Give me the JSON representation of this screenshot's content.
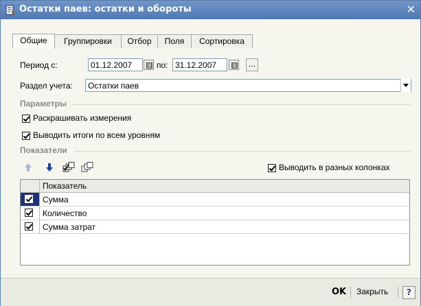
{
  "window": {
    "title": "Остатки паев: остатки и обороты",
    "close_glyph": "✕"
  },
  "tabs": [
    {
      "label": "Общие",
      "active": true
    },
    {
      "label": "Группировки",
      "active": false
    },
    {
      "label": "Отбор",
      "active": false
    },
    {
      "label": "Поля",
      "active": false
    },
    {
      "label": "Сортировка",
      "active": false
    }
  ],
  "period": {
    "label": "Период с:",
    "from": "01.12.2007",
    "to_label": "по:",
    "to": "31.12.2007",
    "more_label": "..."
  },
  "section_field": {
    "label": "Раздел учета:",
    "value": "Остатки паев"
  },
  "params": {
    "title": "Параметры",
    "expand_dimensions": {
      "label": "Раскрашивать измерения",
      "checked": true
    },
    "totals_all_levels": {
      "label": "Выводить итоги по всем уровням",
      "checked": true
    }
  },
  "indicators": {
    "title": "Показатели",
    "toolbar": [
      "arrow-up-icon",
      "arrow-down-icon",
      "check-all-icon",
      "uncheck-all-icon"
    ],
    "separate_columns": {
      "label": "Выводить в разных колонках",
      "checked": true
    },
    "column_header": "Показатель",
    "rows": [
      {
        "label": "Сумма",
        "checked": true,
        "selected": true
      },
      {
        "label": "Количество",
        "checked": true,
        "selected": false
      },
      {
        "label": "Сумма затрат",
        "checked": true,
        "selected": false
      }
    ]
  },
  "footer": {
    "ok_label": "OK",
    "close_label": "Закрыть",
    "help_label": "?"
  },
  "colors": {
    "title_bar": "#5a80bb",
    "selection": "#1f2f7a",
    "section_text": "#8a8a8a"
  }
}
